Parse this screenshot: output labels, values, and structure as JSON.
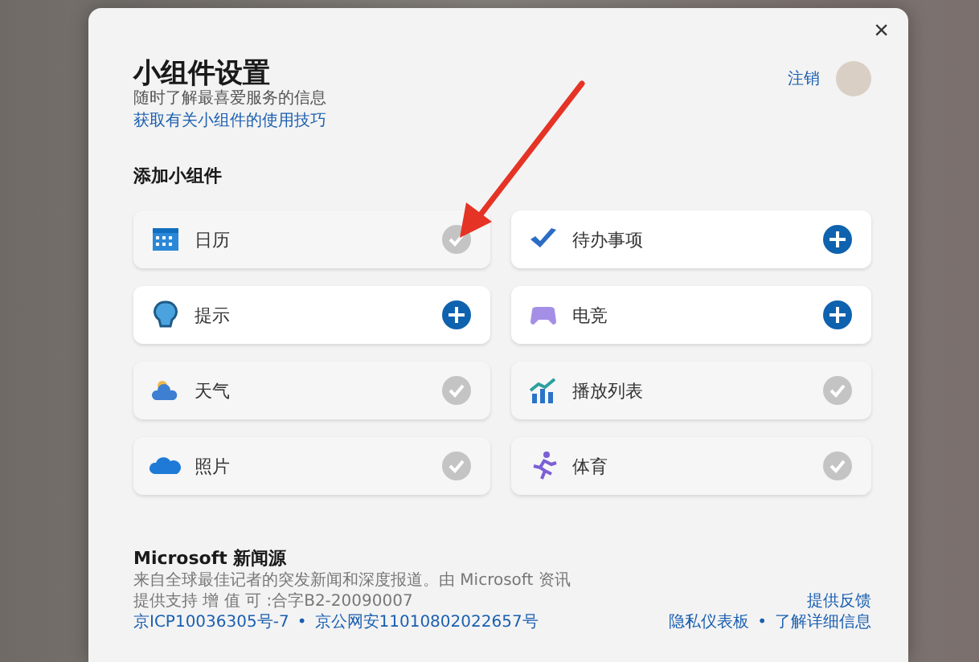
{
  "dialog": {
    "close": "×",
    "title": "小组件设置",
    "subtitle": "随时了解最喜爱服务的信息",
    "tips_link": "获取有关小组件的使用技巧",
    "sign_out": "注销"
  },
  "section_title": "添加小组件",
  "widgets": [
    {
      "label": "日历",
      "added": true
    },
    {
      "label": "待办事项",
      "added": false
    },
    {
      "label": "提示",
      "added": false
    },
    {
      "label": "电竞",
      "added": false
    },
    {
      "label": "天气",
      "added": true
    },
    {
      "label": "播放列表",
      "added": true
    },
    {
      "label": "照片",
      "added": true
    },
    {
      "label": "体育",
      "added": true
    }
  ],
  "news": {
    "title": "Microsoft 新闻源",
    "description": "来自全球最佳记者的突发新闻和深度报道。由 Microsoft 资讯",
    "license": "提供支持 增 值 可 :合字B2-20090007",
    "icp": "京ICP10036305号-7",
    "separator_left": "•",
    "police": "京公网安11010802022657号",
    "feedback": "提供反馈",
    "privacy": "隐私仪表板",
    "separator_right": "•",
    "learn_more": "了解详细信息"
  }
}
